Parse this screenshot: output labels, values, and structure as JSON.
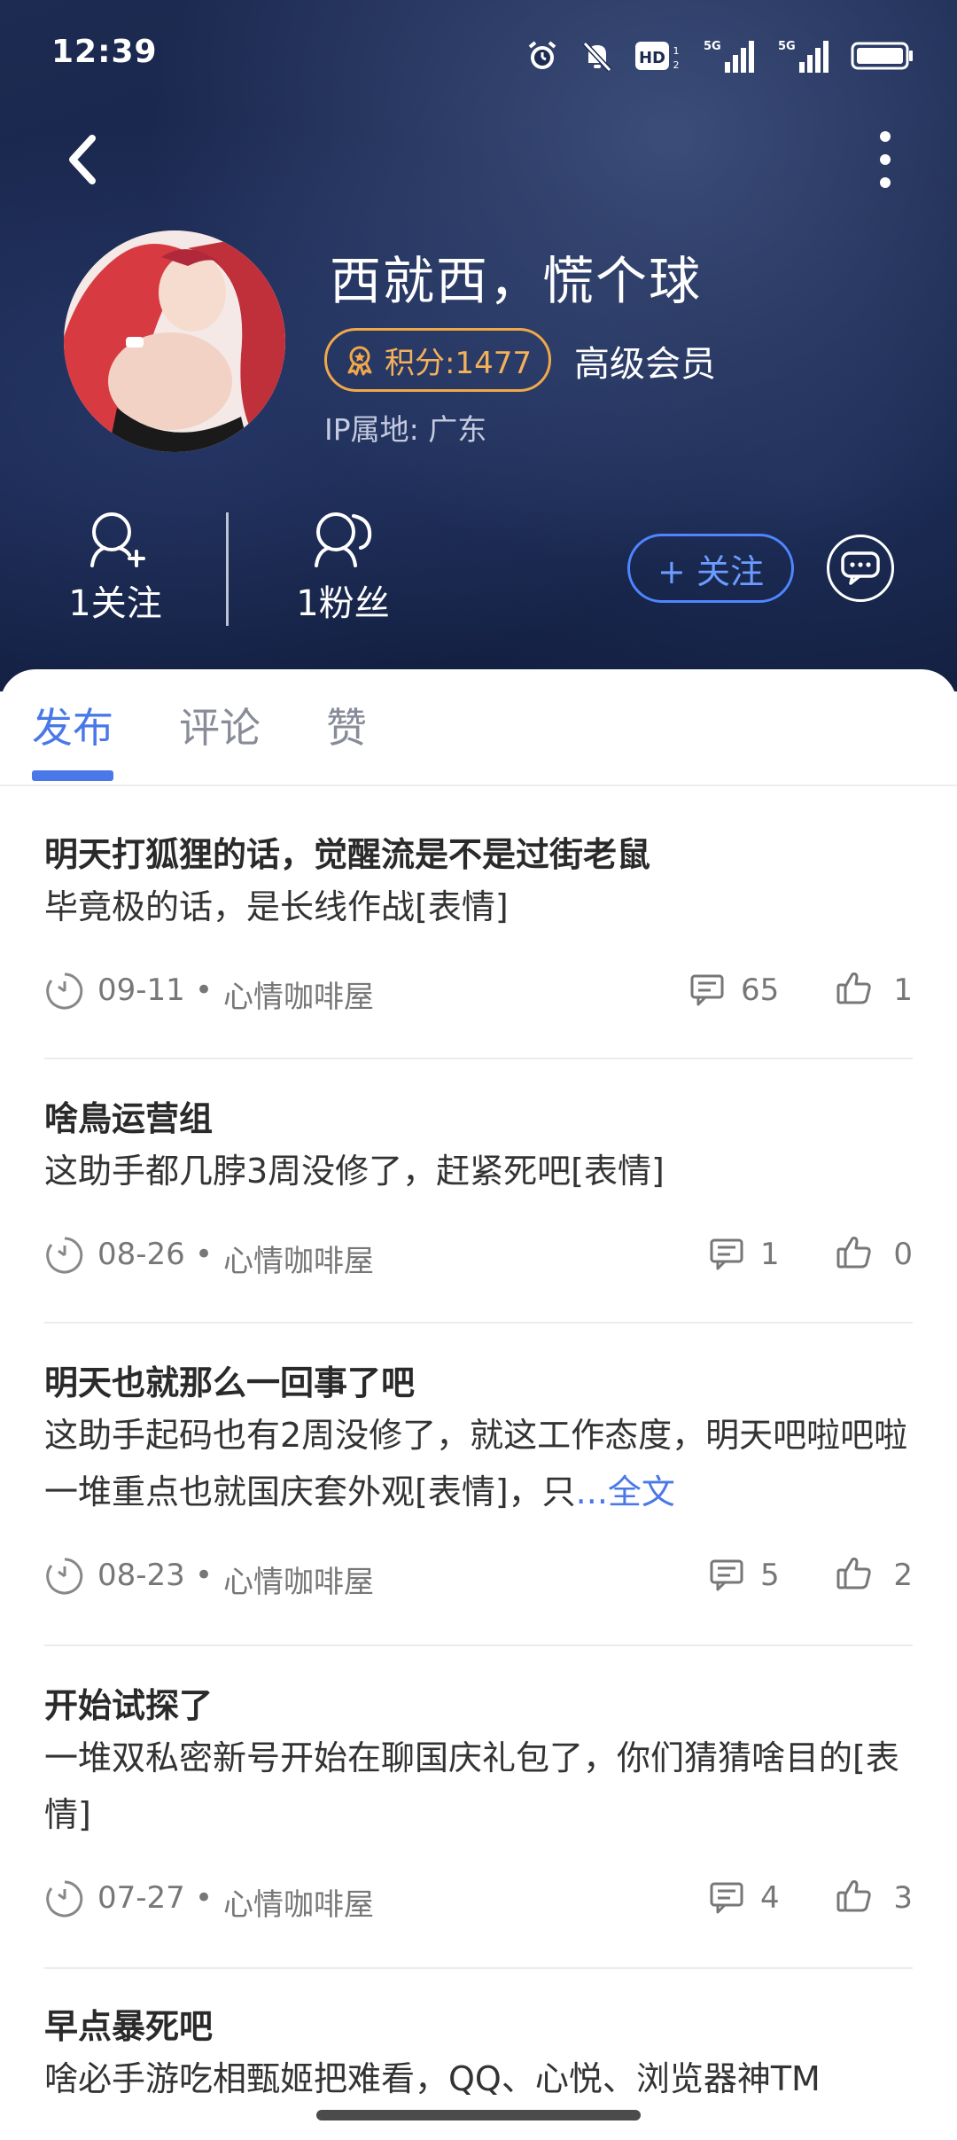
{
  "status_bar": {
    "time": "12:39",
    "network_1": "5G",
    "network_2": "5G",
    "hd_label": "HD"
  },
  "profile": {
    "username": "西就西，慌个球",
    "points": "积分:1477",
    "member_level": "高级会员",
    "ip_location": "IP属地: 广东",
    "following": "1关注",
    "fans": "1粉丝",
    "follow_button": "+ 关注"
  },
  "tabs": [
    {
      "label": "发布",
      "active": true
    },
    {
      "label": "评论",
      "active": false
    },
    {
      "label": "赞",
      "active": false
    }
  ],
  "posts": [
    {
      "title": "明天打狐狸的话，觉醒流是不是过街老鼠",
      "body": "毕竟极的话，是长线作战[表情]",
      "more": "",
      "date": "09-11",
      "category": "心情咖啡屋",
      "comments": "65",
      "likes": "1"
    },
    {
      "title": "啥鳥运营组",
      "body": "这助手都几脖3周没修了，赶紧死吧[表情]",
      "more": "",
      "date": "08-26",
      "category": "心情咖啡屋",
      "comments": "1",
      "likes": "0"
    },
    {
      "title": "明天也就那么一回事了吧",
      "body": "这助手起码也有2周没修了，就这工作态度，明天吧啦吧啦一堆重点也就国庆套外观[表情]，只",
      "more": "...全文",
      "date": "08-23",
      "category": "心情咖啡屋",
      "comments": "5",
      "likes": "2"
    },
    {
      "title": "开始试探了",
      "body": "一堆双私密新号开始在聊国庆礼包了，你们猜猜啥目的[表情]",
      "more": "",
      "date": "07-27",
      "category": "心情咖啡屋",
      "comments": "4",
      "likes": "3"
    },
    {
      "title": "早点暴死吧",
      "body": "啥必手游吃相甄姬把难看，QQ、心悦、浏览器神TM",
      "more": "",
      "date": "",
      "category": "",
      "comments": "",
      "likes": ""
    }
  ],
  "meta_separator": "•",
  "colors": {
    "accent": "#4a78e8",
    "points_orange": "#f0a84a",
    "header_bg": "#16244a"
  }
}
